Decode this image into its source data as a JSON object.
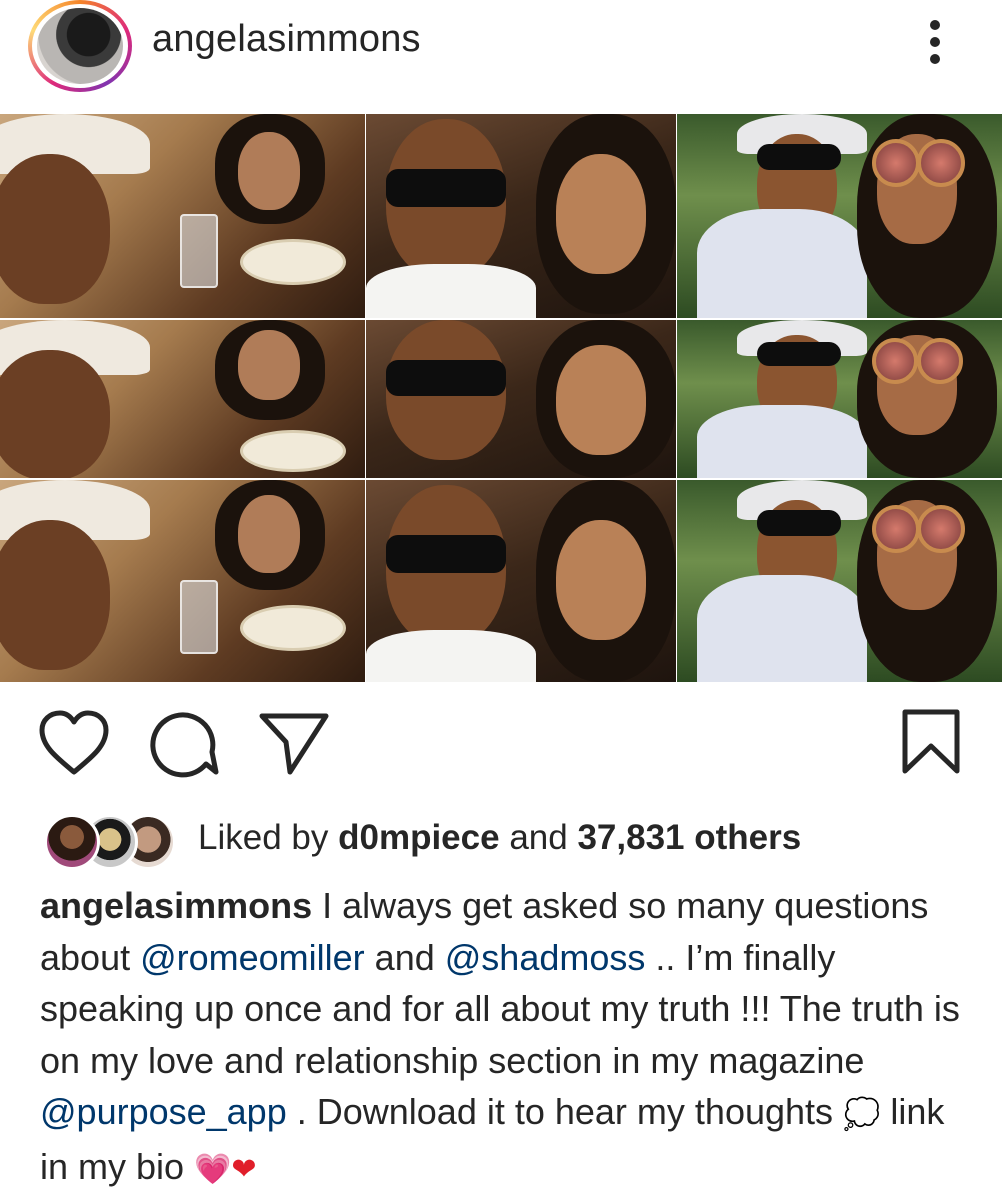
{
  "post": {
    "username": "angelasimmons"
  },
  "actions": {
    "like_icon": "heart-outline-icon",
    "comment_icon": "comment-bubble-icon",
    "share_icon": "paper-plane-icon",
    "save_icon": "bookmark-outline-icon"
  },
  "likes": {
    "prefix": "Liked by",
    "liker": "d0mpiece",
    "connector": "and",
    "count": "37,831 others"
  },
  "caption": {
    "username": "angelasimmons",
    "text_1": " I always get asked so many questions about ",
    "mention_1": "@romeomiller",
    "text_2": " and ",
    "mention_2": "@shadmoss",
    "text_3": " .. I’m finally speaking up once and for all about my truth !!! The truth is on my love and relationship section in my magazine ",
    "mention_3": "@purpose_app",
    "text_4": " . Download it to hear my thoughts ",
    "emoji_thought": "💭",
    "text_5": " link in my bio ",
    "emoji_pink_heart": "💗",
    "emoji_red_heart": "❤"
  },
  "colors": {
    "text": "#262626",
    "mention": "#00376b",
    "background": "#ffffff"
  }
}
